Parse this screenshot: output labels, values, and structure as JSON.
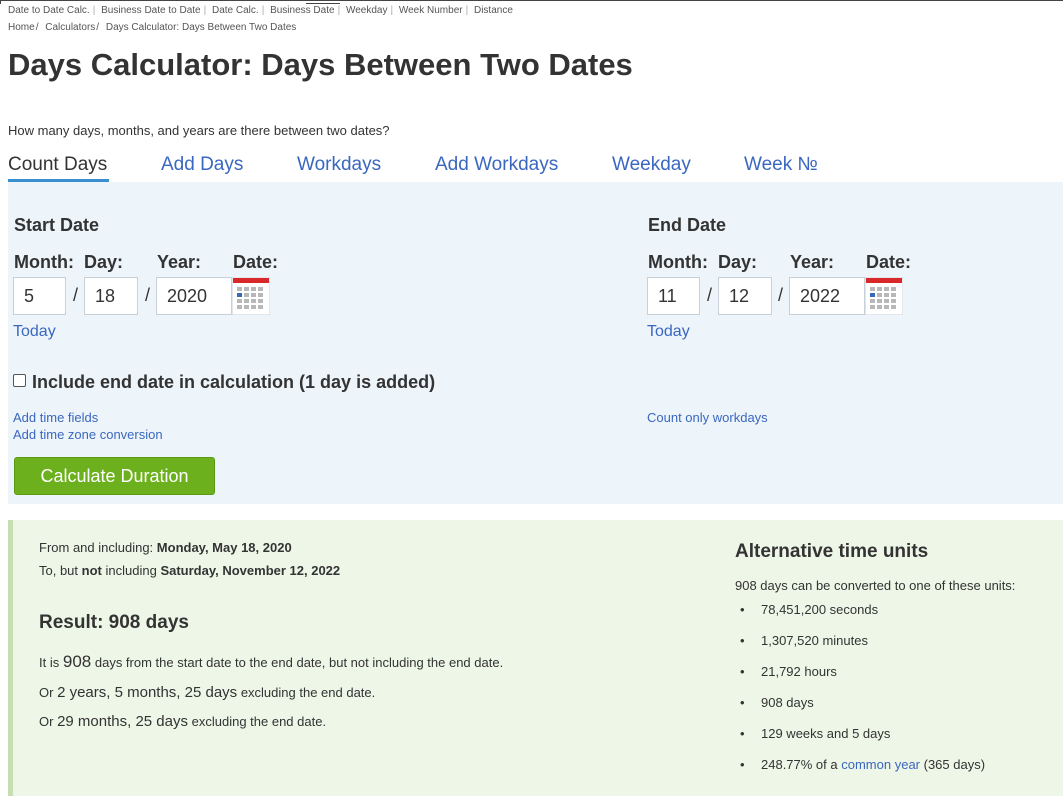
{
  "top_nav": [
    "Date to Date Calc.",
    "Business Date to Date",
    "Date Calc.",
    "Business Date",
    "Weekday",
    "Week Number",
    "Distance"
  ],
  "breadcrumb": [
    "Home",
    "Calculators",
    "Days Calculator: Days Between Two Dates"
  ],
  "page_title": "Days Calculator: Days Between Two Dates",
  "subtitle": "How many days, months, and years are there between two dates?",
  "tabs": [
    "Count Days",
    "Add Days",
    "Workdays",
    "Add Workdays",
    "Weekday",
    "Week №"
  ],
  "active_tab": "Count Days",
  "start": {
    "title": "Start Date",
    "month_label": "Month:",
    "day_label": "Day:",
    "year_label": "Year:",
    "date_label": "Date:",
    "month": "5",
    "day": "18",
    "year": "2020",
    "today": "Today"
  },
  "end": {
    "title": "End Date",
    "month_label": "Month:",
    "day_label": "Day:",
    "year_label": "Year:",
    "date_label": "Date:",
    "month": "11",
    "day": "12",
    "year": "2022",
    "today": "Today"
  },
  "slash": "/",
  "include_end_label": "Include end date in calculation (1 day is added)",
  "include_end_checked": false,
  "links": {
    "add_time": "Add time fields",
    "add_timezone": "Add time zone conversion",
    "workdays_only": "Count only workdays"
  },
  "calculate_button": "Calculate Duration",
  "result": {
    "from_prefix": "From and including:",
    "from_date": "Monday, May 18, 2020",
    "to_prefix1": "To, but",
    "to_not": "not",
    "to_prefix2": "including",
    "to_date": "Saturday, November 12, 2022",
    "title": "Result: 908 days",
    "line1_a": "It is",
    "line1_num": "908",
    "line1_b": "days from the start date to the end date, but not including the end date.",
    "line2_a": "Or",
    "line2_val": "2 years, 5 months, 25 days",
    "line2_b": "excluding the end date.",
    "line3_a": "Or",
    "line3_val": "29 months, 25 days",
    "line3_b": "excluding the end date."
  },
  "alternative": {
    "title": "Alternative time units",
    "intro": "908 days can be converted to one of these units:",
    "items": [
      "78,451,200 seconds",
      "1,307,520 minutes",
      "21,792 hours",
      "908 days",
      "129 weeks and 5 days"
    ],
    "last_prefix": "248.77% of a",
    "last_link": "common year",
    "last_suffix": "(365 days)"
  },
  "colors": {
    "link": "#3a67c0",
    "button": "#6cb11d",
    "form_bg": "#edf4fa",
    "result_bg": "#eef6e8",
    "tab_underline": "#3a8fd0"
  }
}
